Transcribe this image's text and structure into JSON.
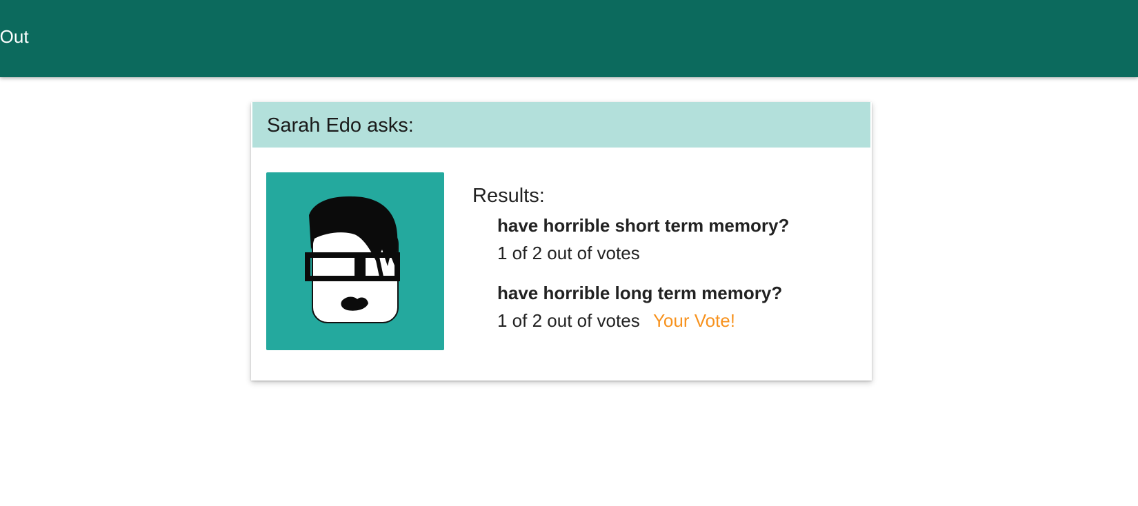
{
  "nav": {
    "signout_label": "n Out"
  },
  "question": {
    "author": "Sarah Edo",
    "asks_label": "asks:",
    "avatar_icon": "avatar-cartoon-face-icon",
    "results_title": "Results:",
    "options": [
      {
        "text": "have horrible short term memory?",
        "count_label": "1 of 2 out of votes",
        "your_vote_label": ""
      },
      {
        "text": "have horrible long term memory?",
        "count_label": "1 of 2 out of votes",
        "your_vote_label": "Your Vote!"
      }
    ]
  },
  "colors": {
    "nav_background": "#0c6a5d",
    "header_background": "#b3e0db",
    "avatar_background": "#24a99e",
    "vote_highlight": "#f7921e"
  }
}
